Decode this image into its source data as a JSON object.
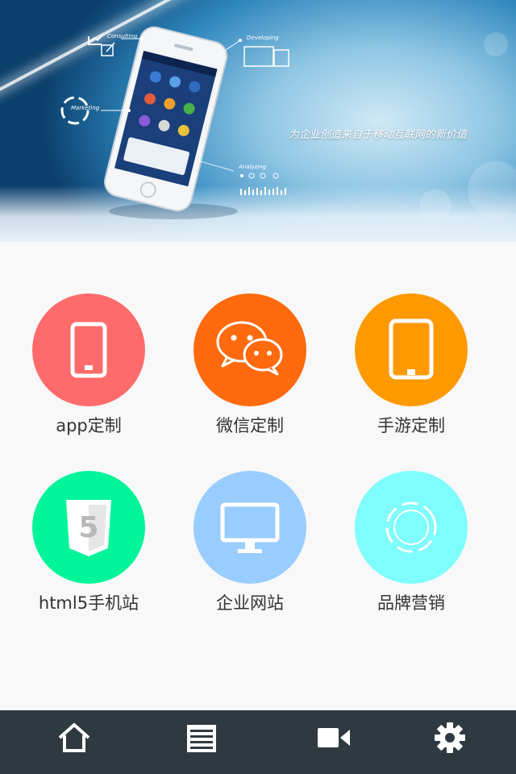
{
  "banner": {
    "slogan": "为企业创造来自于移动互联网的新价值",
    "callouts": {
      "consulting": "Consulting",
      "developing": "Developing",
      "marketing": "Marketing",
      "analyzing": "Analyzing"
    }
  },
  "services": [
    {
      "label": "app定制",
      "icon": "phone-icon",
      "color": "#ff6b6b"
    },
    {
      "label": "微信定制",
      "icon": "wechat-icon",
      "color": "#ff6a0e"
    },
    {
      "label": "手游定制",
      "icon": "tablet-icon",
      "color": "#ff9900"
    },
    {
      "label": "html5手机站",
      "icon": "html5-icon",
      "color": "#00f59a"
    },
    {
      "label": "企业网站",
      "icon": "monitor-icon",
      "color": "#99ccff"
    },
    {
      "label": "品牌营销",
      "icon": "target-ring-icon",
      "color": "#7ffcfc"
    }
  ],
  "nav": {
    "background": "#2f3a40",
    "items": [
      {
        "icon": "home-icon"
      },
      {
        "icon": "list-icon"
      },
      {
        "icon": "video-camera-icon"
      },
      {
        "icon": "gear-icon"
      }
    ]
  }
}
